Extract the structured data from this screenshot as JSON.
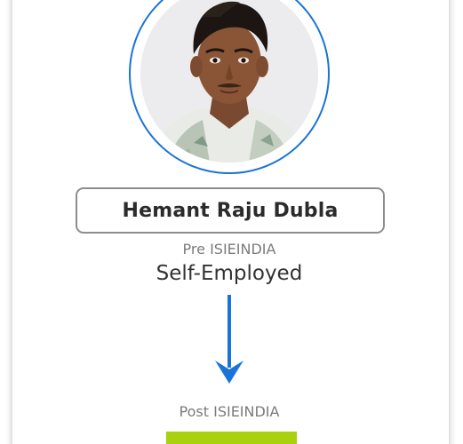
{
  "profile": {
    "name": "Hemant Raju Dubla",
    "photo_alt": "profile-photo"
  },
  "pre": {
    "label": "Pre ISIEINDIA",
    "value": "Self-Employed"
  },
  "post": {
    "label": "Post ISIEINDIA",
    "value": ""
  },
  "colors": {
    "ring": "#1a73d9",
    "arrow": "#1a73d9",
    "badge": "#a9d10e",
    "name_border": "#8d8d8d"
  },
  "icons": {
    "transition": "arrow-down-icon"
  }
}
